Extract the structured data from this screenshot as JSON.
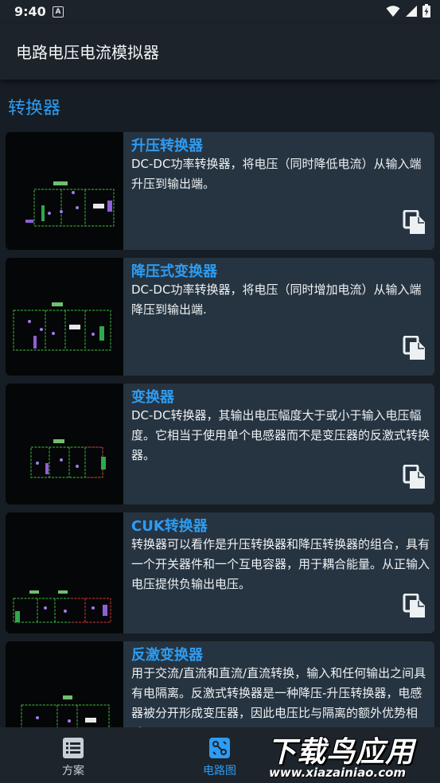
{
  "status": {
    "time": "9:40",
    "notif_icon": "a-letter-icon",
    "icons": [
      "wifi-icon",
      "signal-icon",
      "battery-icon"
    ]
  },
  "app": {
    "title": "电路电压电流模拟器"
  },
  "section": {
    "title": "转换器"
  },
  "cards": [
    {
      "title": "升压转换器",
      "desc": "DC-DC功率转换器，将电压（同时降低电流）从输入端升压到输出端。"
    },
    {
      "title": "降压式变换器",
      "desc": "DC-DC功率转换器，将电压（同时增加电流）从输入端降压到输出端."
    },
    {
      "title": "变换器",
      "desc": "DC-DC转换器，其输出电压幅度大于或小于输入电压幅度。它相当于使用单个电感器而不是变压器的反激式转换器。"
    },
    {
      "title": "CUK转换器",
      "desc": "转换器可以看作是升压转换器和降压转换器的组合，具有一个开关器件和一个互电容器，用于耦合能量。从正输入电压提供负输出电压。"
    },
    {
      "title": "反激变换器",
      "desc": "用于交流/直流和直流/直流转换，输入和任何输出之间具有电隔离。反激式转换器是一种降压-升压转换器，电感器被分开形成变压器，因此电压比与隔离的额外优势相乘。"
    }
  ],
  "nav": [
    {
      "label": "方案",
      "icon": "list-icon"
    },
    {
      "label": "电路图",
      "icon": "circuit-icon"
    }
  ],
  "watermark": {
    "text": "下载鸟应用",
    "url": "www.xiazainiao.com"
  },
  "colors": {
    "accent": "#2d9cf3",
    "card": "#263441",
    "background": "#161d24"
  }
}
